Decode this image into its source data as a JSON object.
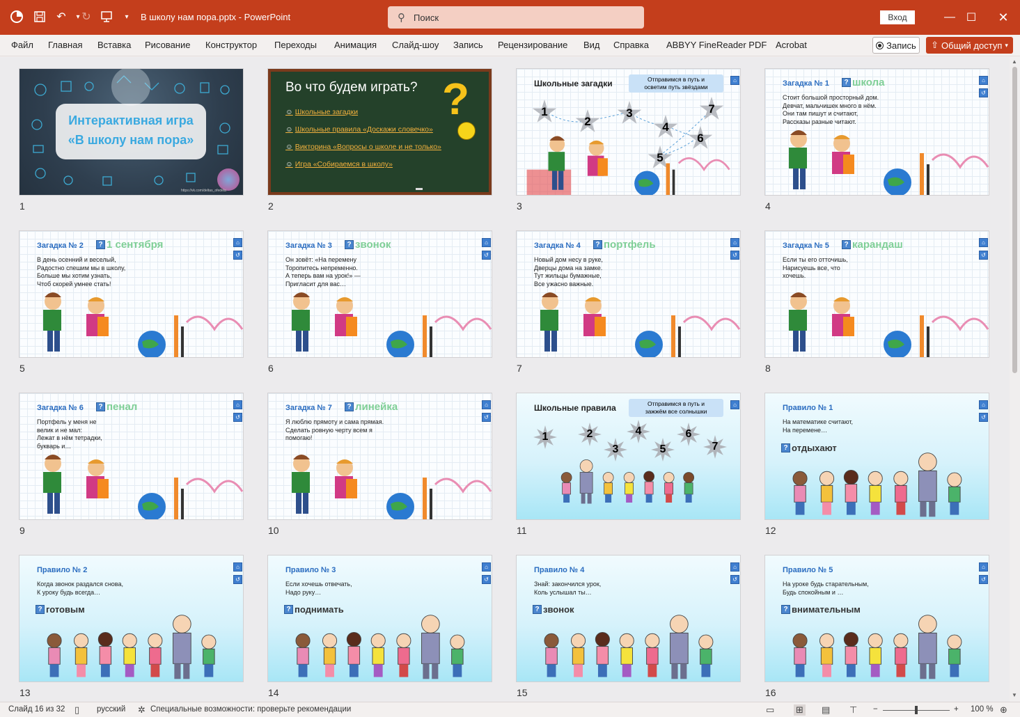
{
  "titlebar": {
    "doc_title": "В школу нам пора.pptx  -  PowerPoint",
    "search_placeholder": "Поиск",
    "login": "Вход",
    "accent": "#c43e1c"
  },
  "menu": {
    "items": [
      "Файл",
      "Главная",
      "Вставка",
      "Рисование",
      "Конструктор",
      "Переходы",
      "Анимация",
      "Слайд-шоу",
      "Запись",
      "Рецензирование",
      "Вид",
      "Справка",
      "ABBYY FineReader PDF",
      "Acrobat"
    ],
    "record": "Запись",
    "share": "Общий доступ"
  },
  "slides": {
    "s1": {
      "num": "1",
      "title1": "Интерактивная игра",
      "title2": "«В школу нам пора»",
      "foot": "https://vk.com/deltas_ofedela"
    },
    "s2": {
      "num": "2",
      "title": "Во что будем играть?",
      "links": [
        "Школьные загадки",
        "Школьные правила «Доскажи словечко»",
        "Викторина «Вопросы о школе и не только»",
        "Игра «Собираемся в школу»"
      ]
    },
    "s3": {
      "num": "3",
      "title": "Школьные загадки",
      "bubble": "Отправимся в путь и\nосветим путь звёздами",
      "stars": [
        "1",
        "2",
        "3",
        "4",
        "5",
        "6",
        "7"
      ]
    },
    "s4": {
      "num": "4",
      "title": "Загадка № 1",
      "answer": "школа",
      "text": "Стоит большой просторный дом.\nДевчат, мальчишек много в нём.\nОни там пишут и считают,\nРассказы разные читают."
    },
    "s5": {
      "num": "5",
      "title": "Загадка № 2",
      "answer": "1 сентября",
      "text": "В день осенний и веселый,\nРадостно спешим мы в школу,\nБольше мы хотим узнать,\nЧтоб скорей умнее стать!"
    },
    "s6": {
      "num": "6",
      "title": "Загадка № 3",
      "answer": "звонок",
      "text": "Он зовёт: «На перемену\nТоропитесь непременно.\nА теперь вам на урок!» —\nПригласит для вас…"
    },
    "s7": {
      "num": "7",
      "title": "Загадка № 4",
      "answer": "портфель",
      "text": "Новый дом несу в руке,\nДверцы дома на замке.\nТут жильцы бумажные,\nВсе ужасно важные."
    },
    "s8": {
      "num": "8",
      "title": "Загадка № 5",
      "answer": "карандаш",
      "text": "Если ты его отточишь,\nНарисуешь все, что\nхочешь."
    },
    "s9": {
      "num": "9",
      "title": "Загадка № 6",
      "answer": "пенал",
      "text": "Портфель у меня не\nвелик и не мал:\nЛежат в нём тетрадки,\nбукварь и…"
    },
    "s10": {
      "num": "10",
      "title": "Загадка № 7",
      "answer": "линейка",
      "text": "Я люблю прямоту и сама прямая.\nСделать ровную черту всем я\nпомогаю!"
    },
    "s11": {
      "num": "11",
      "title": "Школьные правила",
      "bubble": "Отправимся в путь и\nзажжём все солнышки",
      "stars": [
        "1",
        "2",
        "3",
        "4",
        "5",
        "6",
        "7"
      ]
    },
    "s12": {
      "num": "12",
      "title": "Правило № 1",
      "answer": "отдыхают",
      "text": "На математике считают,\nНа перемене…"
    },
    "s13": {
      "num": "13",
      "title": "Правило № 2",
      "answer": "готовым",
      "text": "Когда звонок раздался снова,\nК уроку будь всегда…"
    },
    "s14": {
      "num": "14",
      "title": "Правило № 3",
      "answer": "поднимать",
      "text": "Если хочешь отвечать,\nНадо руку…"
    },
    "s15": {
      "num": "15",
      "title": "Правило № 4",
      "answer": "звонок",
      "text": "Знай: закончился урок,\nКоль услышал ты…"
    },
    "s16": {
      "num": "16",
      "title": "Правило № 5",
      "answer": "внимательным",
      "text": "На уроке будь старательным,\nБудь спокойным и …"
    }
  },
  "status": {
    "slide": "Слайд 16 из 32",
    "lang": "русский",
    "accessibility": "Специальные возможности: проверьте рекомендации",
    "zoom": "100 %"
  }
}
